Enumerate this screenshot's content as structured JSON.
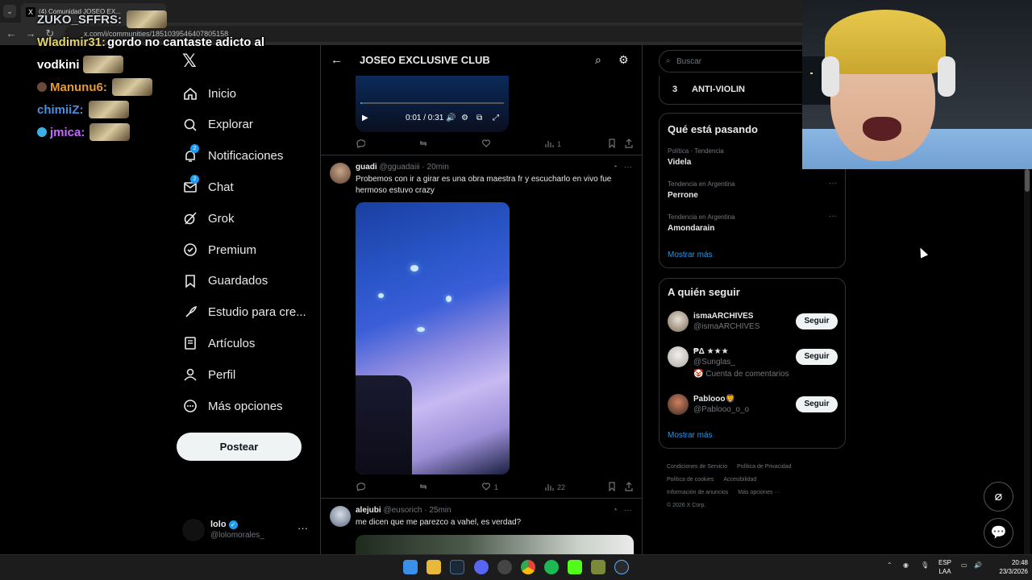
{
  "browser": {
    "tab_title": "(4) Comunidad JOSEO EX...",
    "tab_favicon": "X",
    "url": "x.com/i/communities/1851039546407805158"
  },
  "stream_chat": [
    {
      "name": "ZUKO_SFFRS:",
      "name_color": "#d7dbe0",
      "message": "",
      "has_emote": true,
      "badge": ""
    },
    {
      "name": "Wladimir31:",
      "name_color": "#e3d36a",
      "message": "gordo no cantaste adicto al",
      "has_emote": false,
      "badge": ""
    },
    {
      "name": "",
      "name_color": "#ffffff",
      "message": "vodkini",
      "has_emote": true,
      "badge": ""
    },
    {
      "name": "Manunu6:",
      "name_color": "#e59a2d",
      "message": "",
      "has_emote": true,
      "badge": "dark"
    },
    {
      "name": "chimiiZ:",
      "name_color": "#4a8fe0",
      "message": "",
      "has_emote": true,
      "badge": ""
    },
    {
      "name": "jmica:",
      "name_color": "#c36bff",
      "message": "",
      "has_emote": true,
      "badge": "blue"
    }
  ],
  "nav": {
    "items": [
      {
        "label": "Inicio",
        "icon": "home-icon",
        "badge": ""
      },
      {
        "label": "Explorar",
        "icon": "search-icon",
        "badge": ""
      },
      {
        "label": "Notificaciones",
        "icon": "bell-icon",
        "badge": "2"
      },
      {
        "label": "Chat",
        "icon": "mail-icon",
        "badge": "2"
      },
      {
        "label": "Grok",
        "icon": "grok-icon",
        "badge": ""
      },
      {
        "label": "Premium",
        "icon": "premium-icon",
        "badge": ""
      },
      {
        "label": "Guardados",
        "icon": "bookmark-icon",
        "badge": ""
      },
      {
        "label": "Estudio para cre...",
        "icon": "rocket-icon",
        "badge": ""
      },
      {
        "label": "Artículos",
        "icon": "article-icon",
        "badge": ""
      },
      {
        "label": "Perfil",
        "icon": "person-icon",
        "badge": ""
      },
      {
        "label": "Más opciones",
        "icon": "more-circle-icon",
        "badge": ""
      }
    ],
    "post_label": "Postear"
  },
  "account": {
    "name": "lolo",
    "handle": "@lolomorales_"
  },
  "community": {
    "title": "JOSEO EXCLUSIVE CLUB"
  },
  "tweets": [
    {
      "video_time": "0:01 / 0:31",
      "video_progress": 0.01,
      "replies": "",
      "retweets": "",
      "likes": "",
      "views": "1"
    },
    {
      "name": "guadi",
      "handle": "@gguadaiii",
      "time": "20min",
      "text": "Probemos con ir a girar es una obra maestra fr y escucharlo en vivo fue hermoso estuvo crazy",
      "replies": "",
      "retweets": "",
      "likes": "1",
      "views": "22"
    },
    {
      "name": "alejubi",
      "handle": "@eusorich",
      "time": "25min",
      "text": "me dicen que me parezco a vahel, es verdad?"
    }
  ],
  "right": {
    "search_placeholder": "Buscar",
    "top_rank": "3",
    "top_rank_label": "ANTI-VIOLIN",
    "trends_title": "Qué está pasando",
    "trends": [
      {
        "category": "Política · Tendencia",
        "name": "Videla"
      },
      {
        "category": "Tendencia en Argentina",
        "name": "Perrone"
      },
      {
        "category": "Tendencia en Argentina",
        "name": "Amondarain"
      }
    ],
    "show_more": "Mostrar más",
    "follow_title": "A quién seguir",
    "follow": [
      {
        "name": "ismaARCHIVES",
        "handle": "@ismaARCHIVES",
        "note": ""
      },
      {
        "name": "₱Δ ★★★",
        "handle": "@Sunglas_",
        "note": "🤡 Cuenta de comentarios"
      },
      {
        "name": "Pablooo🦁",
        "handle": "@Pablooo_o_o",
        "note": ""
      }
    ],
    "follow_label": "Seguir",
    "footer": [
      "Condiciones de Servicio",
      "Política de Privacidad",
      "Política de cookies",
      "Accesibilidad",
      "Información de anuncios",
      "Más opciones ···",
      "© 2026 X Corp."
    ]
  },
  "taskbar": {
    "lang_line1": "ESP",
    "lang_line2": "LAA",
    "time": "20:48",
    "date": "23/3/2026"
  }
}
